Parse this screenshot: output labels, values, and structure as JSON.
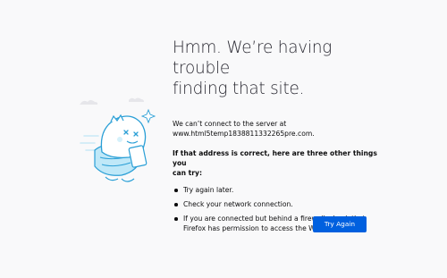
{
  "error": {
    "title_line1": "Hmm. We’re having trouble",
    "title_line2": "finding that site.",
    "message_line1": "We can’t connect to the server at",
    "message_line2": "www.html5temp1838811332265pre.com.",
    "subheading_line1": "If that address is correct, here are three other things you",
    "subheading_line2": "can try:",
    "tips": [
      {
        "line1": "Try again later."
      },
      {
        "line1": "Check your network connection."
      },
      {
        "line1": "If you are connected but behind a firewall, check that",
        "line2": "Firefox has permission to access the Web."
      }
    ],
    "illustration_icon": "dizzy-dinosaur-icon"
  },
  "actions": {
    "try_again_label": "Try Again"
  },
  "colors": {
    "background": "#f9f9fa",
    "button": "#0060df",
    "illustration_accent": "#45c6ef"
  }
}
